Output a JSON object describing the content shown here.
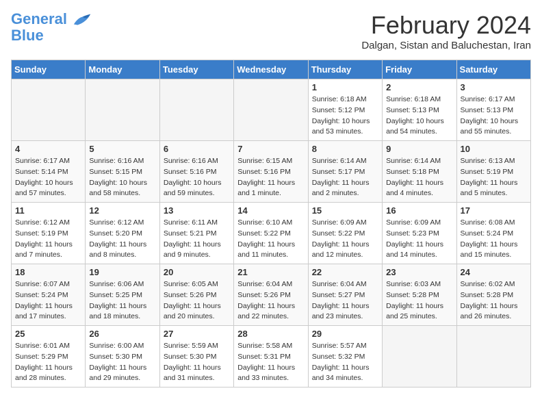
{
  "logo": {
    "line1": "General",
    "line2": "Blue"
  },
  "title": "February 2024",
  "subtitle": "Dalgan, Sistan and Baluchestan, Iran",
  "days_of_week": [
    "Sunday",
    "Monday",
    "Tuesday",
    "Wednesday",
    "Thursday",
    "Friday",
    "Saturday"
  ],
  "weeks": [
    [
      {
        "day": "",
        "empty": true
      },
      {
        "day": "",
        "empty": true
      },
      {
        "day": "",
        "empty": true
      },
      {
        "day": "",
        "empty": true
      },
      {
        "day": "1",
        "sunrise": "6:18 AM",
        "sunset": "5:12 PM",
        "daylight": "10 hours and 53 minutes."
      },
      {
        "day": "2",
        "sunrise": "6:18 AM",
        "sunset": "5:13 PM",
        "daylight": "10 hours and 54 minutes."
      },
      {
        "day": "3",
        "sunrise": "6:17 AM",
        "sunset": "5:13 PM",
        "daylight": "10 hours and 55 minutes."
      }
    ],
    [
      {
        "day": "4",
        "sunrise": "6:17 AM",
        "sunset": "5:14 PM",
        "daylight": "10 hours and 57 minutes."
      },
      {
        "day": "5",
        "sunrise": "6:16 AM",
        "sunset": "5:15 PM",
        "daylight": "10 hours and 58 minutes."
      },
      {
        "day": "6",
        "sunrise": "6:16 AM",
        "sunset": "5:16 PM",
        "daylight": "10 hours and 59 minutes."
      },
      {
        "day": "7",
        "sunrise": "6:15 AM",
        "sunset": "5:16 PM",
        "daylight": "11 hours and 1 minute."
      },
      {
        "day": "8",
        "sunrise": "6:14 AM",
        "sunset": "5:17 PM",
        "daylight": "11 hours and 2 minutes."
      },
      {
        "day": "9",
        "sunrise": "6:14 AM",
        "sunset": "5:18 PM",
        "daylight": "11 hours and 4 minutes."
      },
      {
        "day": "10",
        "sunrise": "6:13 AM",
        "sunset": "5:19 PM",
        "daylight": "11 hours and 5 minutes."
      }
    ],
    [
      {
        "day": "11",
        "sunrise": "6:12 AM",
        "sunset": "5:19 PM",
        "daylight": "11 hours and 7 minutes."
      },
      {
        "day": "12",
        "sunrise": "6:12 AM",
        "sunset": "5:20 PM",
        "daylight": "11 hours and 8 minutes."
      },
      {
        "day": "13",
        "sunrise": "6:11 AM",
        "sunset": "5:21 PM",
        "daylight": "11 hours and 9 minutes."
      },
      {
        "day": "14",
        "sunrise": "6:10 AM",
        "sunset": "5:22 PM",
        "daylight": "11 hours and 11 minutes."
      },
      {
        "day": "15",
        "sunrise": "6:09 AM",
        "sunset": "5:22 PM",
        "daylight": "11 hours and 12 minutes."
      },
      {
        "day": "16",
        "sunrise": "6:09 AM",
        "sunset": "5:23 PM",
        "daylight": "11 hours and 14 minutes."
      },
      {
        "day": "17",
        "sunrise": "6:08 AM",
        "sunset": "5:24 PM",
        "daylight": "11 hours and 15 minutes."
      }
    ],
    [
      {
        "day": "18",
        "sunrise": "6:07 AM",
        "sunset": "5:24 PM",
        "daylight": "11 hours and 17 minutes."
      },
      {
        "day": "19",
        "sunrise": "6:06 AM",
        "sunset": "5:25 PM",
        "daylight": "11 hours and 18 minutes."
      },
      {
        "day": "20",
        "sunrise": "6:05 AM",
        "sunset": "5:26 PM",
        "daylight": "11 hours and 20 minutes."
      },
      {
        "day": "21",
        "sunrise": "6:04 AM",
        "sunset": "5:26 PM",
        "daylight": "11 hours and 22 minutes."
      },
      {
        "day": "22",
        "sunrise": "6:04 AM",
        "sunset": "5:27 PM",
        "daylight": "11 hours and 23 minutes."
      },
      {
        "day": "23",
        "sunrise": "6:03 AM",
        "sunset": "5:28 PM",
        "daylight": "11 hours and 25 minutes."
      },
      {
        "day": "24",
        "sunrise": "6:02 AM",
        "sunset": "5:28 PM",
        "daylight": "11 hours and 26 minutes."
      }
    ],
    [
      {
        "day": "25",
        "sunrise": "6:01 AM",
        "sunset": "5:29 PM",
        "daylight": "11 hours and 28 minutes."
      },
      {
        "day": "26",
        "sunrise": "6:00 AM",
        "sunset": "5:30 PM",
        "daylight": "11 hours and 29 minutes."
      },
      {
        "day": "27",
        "sunrise": "5:59 AM",
        "sunset": "5:30 PM",
        "daylight": "11 hours and 31 minutes."
      },
      {
        "day": "28",
        "sunrise": "5:58 AM",
        "sunset": "5:31 PM",
        "daylight": "11 hours and 33 minutes."
      },
      {
        "day": "29",
        "sunrise": "5:57 AM",
        "sunset": "5:32 PM",
        "daylight": "11 hours and 34 minutes."
      },
      {
        "day": "",
        "empty": true
      },
      {
        "day": "",
        "empty": true
      }
    ]
  ]
}
